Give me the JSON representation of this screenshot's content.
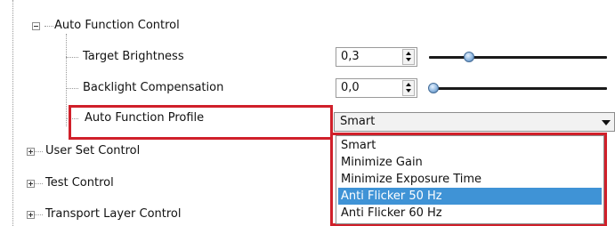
{
  "tree": {
    "auto_function_control": {
      "label": "Auto Function Control",
      "children": {
        "target_brightness": {
          "label": "Target Brightness",
          "value": "0,3",
          "slider_fraction": 0.3
        },
        "backlight_compensation": {
          "label": "Backlight Compensation",
          "value": "0,0",
          "slider_fraction": 0.0
        },
        "auto_function_profile": {
          "label": "Auto Function Profile",
          "selected": "Smart",
          "options": [
            "Smart",
            "Minimize Gain",
            "Minimize Exposure Time",
            "Anti Flicker 50 Hz",
            "Anti Flicker 60 Hz"
          ],
          "highlighted_option": "Anti Flicker 50 Hz"
        }
      }
    },
    "user_set_control": {
      "label": "User Set Control"
    },
    "test_control": {
      "label": "Test Control"
    },
    "transport_layer_control": {
      "label": "Transport Layer Control"
    }
  },
  "colors": {
    "highlight_box": "#d0202a",
    "selection": "#3f93d6",
    "slider_track": "#1a1a1a"
  }
}
